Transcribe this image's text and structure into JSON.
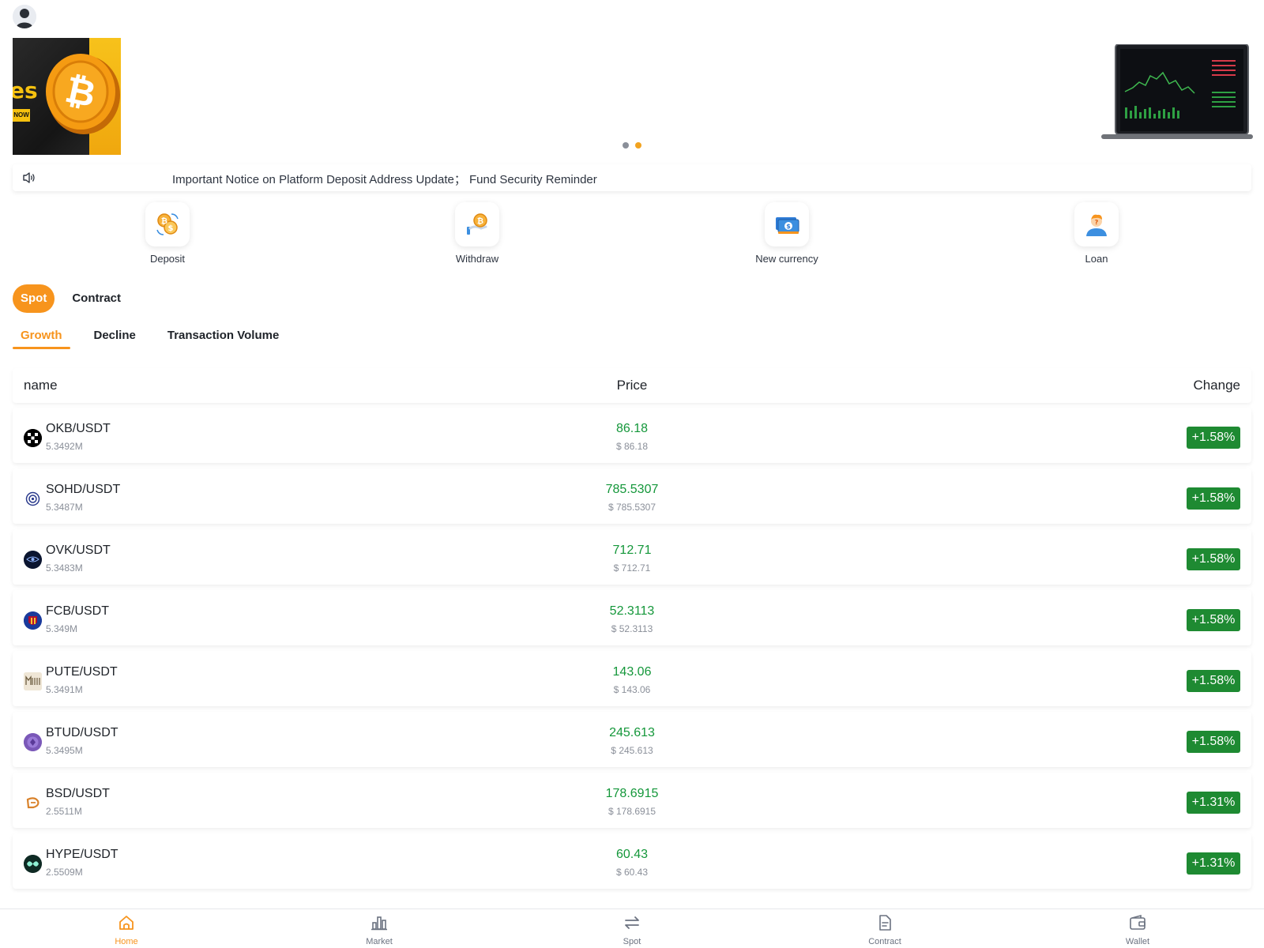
{
  "notice": {
    "text": "Important Notice on Platform Deposit Address Update；  Fund Security Reminder"
  },
  "banner": {
    "left_text": "es",
    "left_button": "NOW",
    "active_slide": 2,
    "slide_count": 2
  },
  "quick_actions": [
    {
      "label": "Deposit",
      "icon": "deposit-icon"
    },
    {
      "label": "Withdraw",
      "icon": "withdraw-icon"
    },
    {
      "label": "New currency",
      "icon": "new-currency-icon"
    },
    {
      "label": "Loan",
      "icon": "loan-icon"
    }
  ],
  "market_tabs": [
    {
      "label": "Spot",
      "active": true
    },
    {
      "label": "Contract",
      "active": false
    }
  ],
  "sort_tabs": [
    {
      "label": "Growth",
      "active": true
    },
    {
      "label": "Decline",
      "active": false
    },
    {
      "label": "Transaction Volume",
      "active": false
    }
  ],
  "table": {
    "headers": {
      "name": "name",
      "price": "Price",
      "change": "Change"
    },
    "rows": [
      {
        "pair": "OKB/USDT",
        "volume": "5.3492M",
        "price": "86.18",
        "usd": "$ 86.18",
        "change": "+1.58%",
        "logo": "okb-logo"
      },
      {
        "pair": "SOHD/USDT",
        "volume": "5.3487M",
        "price": "785.5307",
        "usd": "$ 785.5307",
        "change": "+1.58%",
        "logo": "sohd-logo"
      },
      {
        "pair": "OVK/USDT",
        "volume": "5.3483M",
        "price": "712.71",
        "usd": "$ 712.71",
        "change": "+1.58%",
        "logo": "ovk-logo"
      },
      {
        "pair": "FCB/USDT",
        "volume": "5.349M",
        "price": "52.3113",
        "usd": "$ 52.3113",
        "change": "+1.58%",
        "logo": "fcb-logo"
      },
      {
        "pair": "PUTE/USDT",
        "volume": "5.3491M",
        "price": "143.06",
        "usd": "$ 143.06",
        "change": "+1.58%",
        "logo": "pute-logo"
      },
      {
        "pair": "BTUD/USDT",
        "volume": "5.3495M",
        "price": "245.613",
        "usd": "$ 245.613",
        "change": "+1.58%",
        "logo": "btud-logo"
      },
      {
        "pair": "BSD/USDT",
        "volume": "2.5511M",
        "price": "178.6915",
        "usd": "$ 178.6915",
        "change": "+1.31%",
        "logo": "bsd-logo"
      },
      {
        "pair": "HYPE/USDT",
        "volume": "2.5509M",
        "price": "60.43",
        "usd": "$ 60.43",
        "change": "+1.31%",
        "logo": "hype-logo"
      }
    ]
  },
  "bottom_nav": [
    {
      "label": "Home",
      "icon": "home-icon",
      "active": true
    },
    {
      "label": "Market",
      "icon": "market-icon",
      "active": false
    },
    {
      "label": "Spot",
      "icon": "spot-icon",
      "active": false
    },
    {
      "label": "Contract",
      "icon": "contract-icon",
      "active": false
    },
    {
      "label": "Wallet",
      "icon": "wallet-icon",
      "active": false
    }
  ],
  "colors": {
    "accent": "#f7941d",
    "positive": "#14973a",
    "positive_badge": "#1e8a32",
    "muted": "#8a8f99"
  }
}
